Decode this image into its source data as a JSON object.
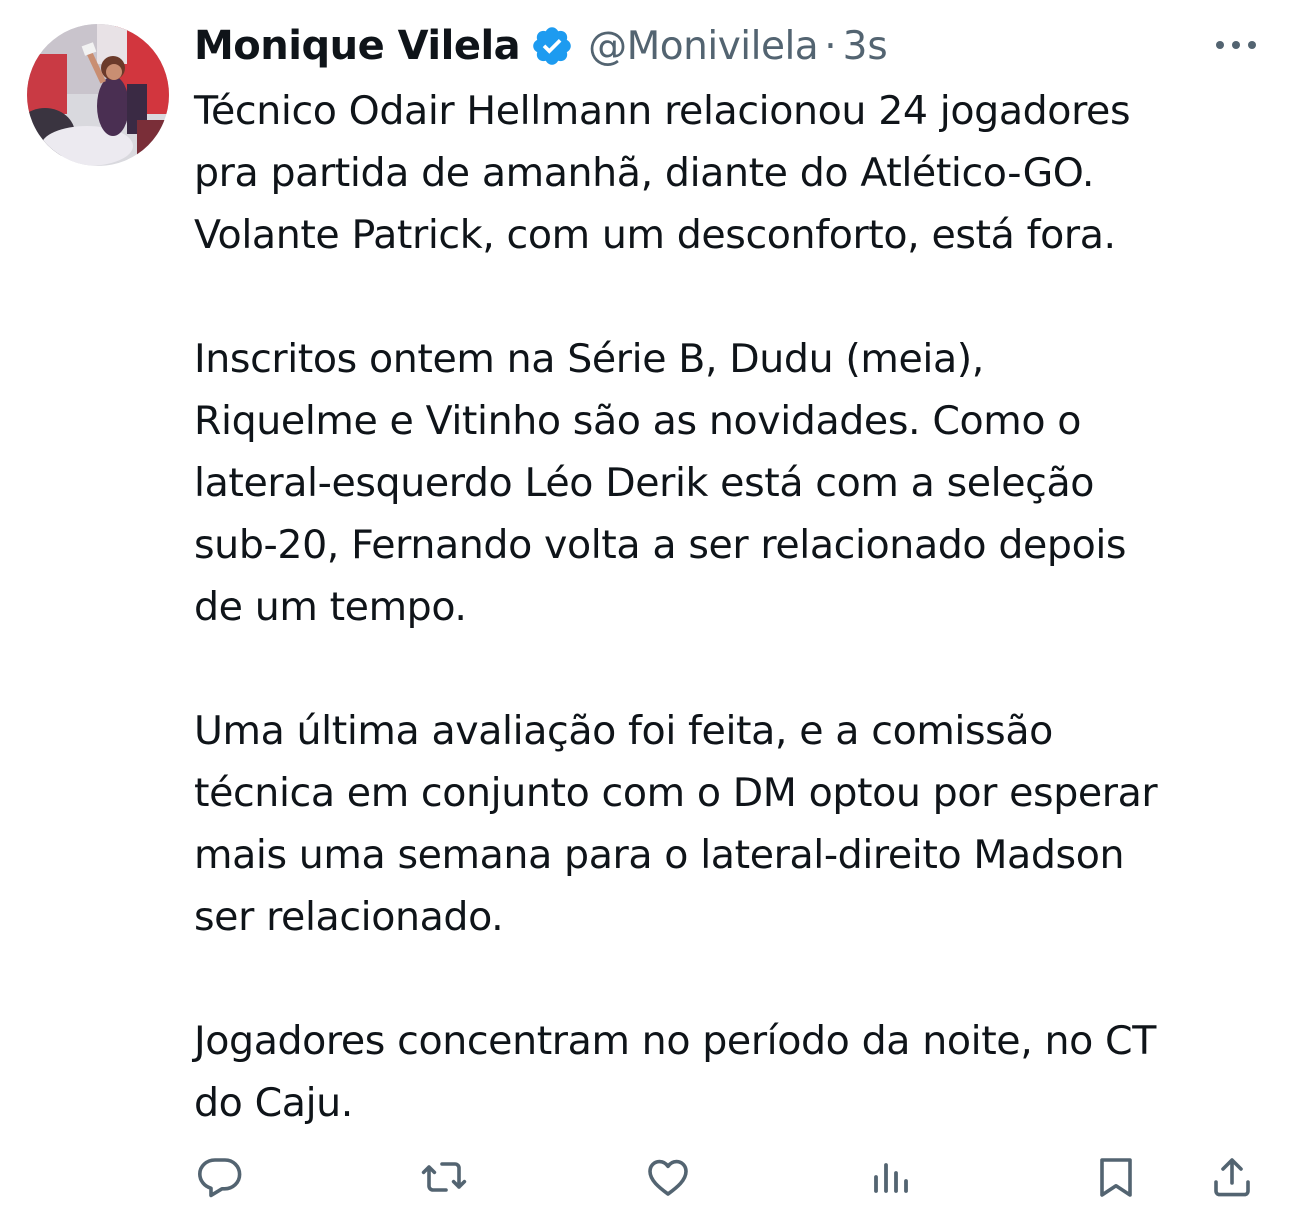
{
  "author": {
    "display_name": "Monique Vilela",
    "handle": "@Monivilela",
    "separator": "·",
    "timestamp": "3s",
    "verified": true,
    "avatar_icon": "profile-photo"
  },
  "tweet": {
    "paragraphs": [
      {
        "lines": [
          "Técnico Odair Hellmann relacionou 24 jogadores",
          "pra partida de amanhã, diante do Atlético-GO.",
          "Volante Patrick, com um desconforto, está fora."
        ]
      },
      {
        "lines": [
          "Inscritos ontem na Série B, Dudu (meia),",
          "Riquelme e Vitinho são as novidades. Como o",
          "lateral-esquerdo Léo Derik está com a seleção",
          "sub-20, Fernando volta a ser relacionado depois",
          "de um tempo."
        ]
      },
      {
        "lines": [
          "Uma última avaliação foi feita, e a comissão",
          "técnica em conjunto com o DM optou por esperar",
          "mais uma semana para o lateral-direito Madson",
          "ser relacionado."
        ]
      },
      {
        "lines": [
          "Jogadores concentram no período da noite, no CT",
          "do Caju."
        ]
      }
    ]
  },
  "actions": [
    {
      "icon": "reply-icon"
    },
    {
      "icon": "retweet-icon"
    },
    {
      "icon": "like-icon"
    },
    {
      "icon": "views-icon"
    },
    {
      "icon": "bookmark-icon"
    },
    {
      "icon": "share-icon"
    }
  ],
  "colors": {
    "text": "#0f1419",
    "secondary": "#536471",
    "verified": "#1d9bf0",
    "icon": "#536471",
    "background": "#ffffff"
  }
}
